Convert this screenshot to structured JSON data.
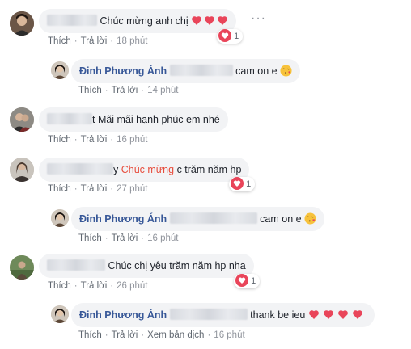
{
  "actions": {
    "like": "Thích",
    "reply": "Trả lời",
    "see_translation": "Xem bản dịch"
  },
  "comments": [
    {
      "text": "Chúc mừng anh chị",
      "time": "18 phút",
      "reaction_count": "1",
      "emoji": "three red hearts"
    },
    {
      "author": "Đinh Phương Ánh",
      "text": "cam on e",
      "time": "14 phút",
      "emoji": "face blowing kiss"
    },
    {
      "text": "t Mãi mãi hạnh phúc em nhé",
      "time": "16 phút"
    },
    {
      "text_prefix": "y",
      "highlight": "Chúc mừng",
      "text": "c trăm năm hp",
      "time": "27 phút",
      "reaction_count": "1"
    },
    {
      "author": "Đinh Phương Ánh",
      "text": "cam on e",
      "time": "16 phút",
      "emoji": "face blowing kiss"
    },
    {
      "text": "Chúc chị yêu trăm năm hp nha",
      "time": "26 phút",
      "reaction_count": "1"
    },
    {
      "author": "Đinh Phương Ánh",
      "text": "thank be ieu",
      "time": "16 phút",
      "emoji": "four red hearts"
    }
  ],
  "colors": {
    "link": "#385898",
    "bubble": "#f2f3f5",
    "meta": "#606770",
    "heart": "#e9455a",
    "highlight": "#e74c3c"
  }
}
